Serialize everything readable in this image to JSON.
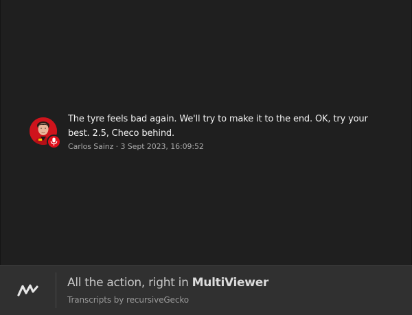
{
  "message": {
    "text": "The tyre feels bad again. We'll try to make it to the end. OK, try your best. 2.5, Checo behind.",
    "meta": "Carlos Sainz · 3 Sept 2023, 16:09:52",
    "icons": [
      "driver-avatar",
      "microphone-icon"
    ]
  },
  "footer": {
    "tagline_prefix": "All the action, right in ",
    "tagline_brand": "MultiViewer",
    "credit": "Transcripts by recursiveGecko",
    "logo_icon": "multiviewer-logo-icon"
  },
  "colors": {
    "background": "#1f1f1f",
    "footer_background": "#303030",
    "badge_red": "#e0101c",
    "avatar_red": "#d1121b"
  }
}
